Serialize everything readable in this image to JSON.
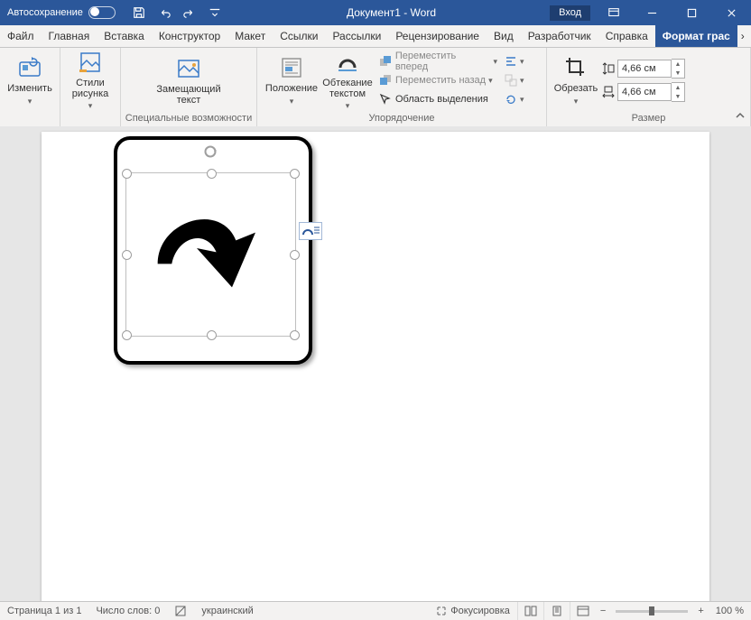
{
  "title": {
    "autosave": "Автосохранение",
    "docname": "Документ1 - Word",
    "signin": "Вход"
  },
  "tabs": {
    "file": "Файл",
    "home": "Главная",
    "insert": "Вставка",
    "design": "Конструктор",
    "layout": "Макет",
    "ref": "Ссылки",
    "mail": "Рассылки",
    "review": "Рецензирование",
    "view": "Вид",
    "dev": "Разработчик",
    "help": "Справка",
    "format": "Формат грас"
  },
  "ribbon": {
    "change": "Изменить",
    "styles": "Стили рисунка",
    "alt": "Замещающий текст",
    "position": "Положение",
    "wrap": "Обтекание текстом",
    "fwd": "Переместить вперед",
    "back": "Переместить назад",
    "selpane": "Область выделения",
    "crop": "Обрезать",
    "heightVal": "4,66 см",
    "widthVal": "4,66 см",
    "grp_acc": "Специальные возможности",
    "grp_arr": "Упорядочение",
    "grp_size": "Размер"
  },
  "status": {
    "page": "Страница 1 из 1",
    "words": "Число слов: 0",
    "lang": "украинский",
    "focus": "Фокусировка",
    "zoom": "100 %"
  }
}
